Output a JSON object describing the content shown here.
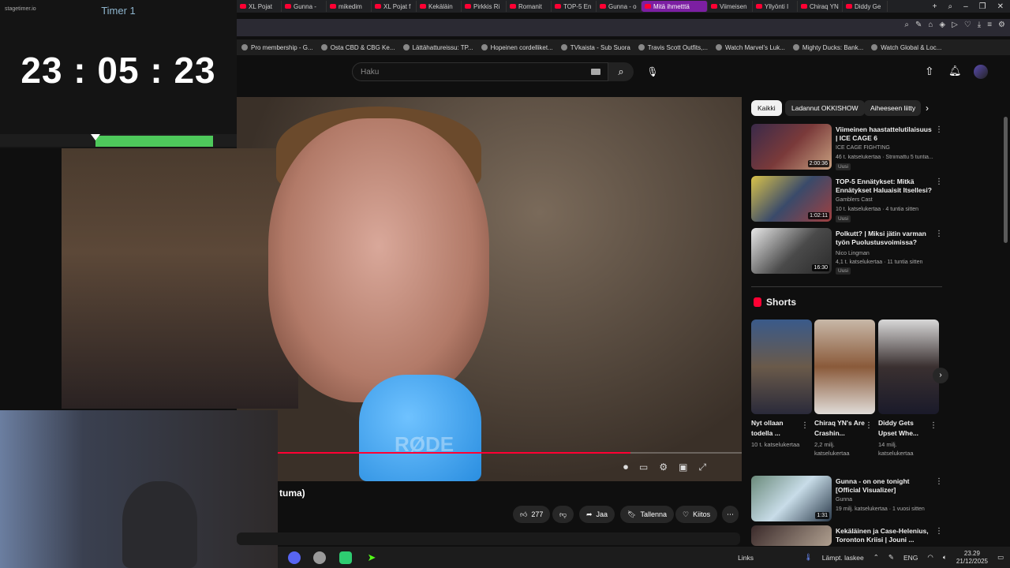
{
  "browser": {
    "tabs": [
      "XL Pojat",
      "Gunna -",
      "mikedim",
      "XL Pojat f",
      "Kekäläin",
      "Pirkkis Ri",
      "Romanit",
      "TOP-5 En",
      "Gunna - o",
      "Mitä ihmetttä",
      "Viimeisen",
      "Yllyönti I",
      "Chiraq YN",
      "Diddy Ge"
    ],
    "active_tab_index": 9,
    "bookmarks": [
      "Pro membership - G...",
      "Osta CBD & CBG Ke...",
      "Lättähattureissu: TP...",
      "Hopeinen cordelliket...",
      "TVkaista - Sub Suora",
      "Travis Scott Outfits,...",
      "Watch Marvel's Luk...",
      "Mighty Ducks: Bank...",
      "Watch Global & Loc..."
    ]
  },
  "timer": {
    "app_label": "stagetimer.io",
    "title": "Timer 1",
    "time": "23 : 05 : 23",
    "progress_fraction": 0.6
  },
  "youtube": {
    "search_placeholder": "Haku",
    "video_title_fragment": "tuma)",
    "video_progress_fraction": 0.78,
    "actions": {
      "likes": "277",
      "share": "Jaa",
      "save": "Tallenna",
      "thanks": "Kiitos"
    },
    "chips": [
      "Kaikki",
      "Ladannut OKKISHOW",
      "Aiheeseen liitty"
    ],
    "recommended": [
      {
        "title": "Viimeinen haastattelutilaisuus | ICE CAGE 6",
        "channel": "ICE CAGE FIGHTING",
        "meta": "46 t. katselukertaa · Striimattu 5 tuntia...",
        "duration": "2:00:36",
        "badge": "Uusi"
      },
      {
        "title": "TOP-5 Ennätykset: Mitkä Ennätykset Haluaisit Itsellesi?",
        "channel": "Gamblers Cast",
        "meta": "10 t. katselukertaa · 4 tuntia sitten",
        "duration": "1:02:11",
        "badge": "Uusi"
      },
      {
        "title": "Polkutt? | Miksi jätin varman työn Puolustusvoimissa?",
        "channel": "Nico Lingman",
        "meta": "4,1 t. katselukertaa · 11 tuntia sitten",
        "duration": "16:30",
        "badge": "Uusi"
      }
    ],
    "shorts_header": "Shorts",
    "shorts": [
      {
        "title": "Nyt ollaan todella ...",
        "views": "10 t. katselukertaa"
      },
      {
        "title": "Chiraq YN's Are Crashin...",
        "views": "2,2 milj. katselukertaa"
      },
      {
        "title": "Diddy Gets Upset Whe...",
        "views": "14 milj. katselukertaa"
      }
    ],
    "more": [
      {
        "title": "Gunna - on one tonight [Official Visualizer]",
        "channel": "Gunna",
        "meta": "19 milj. katselukertaa · 1 vuosi sitten",
        "duration": "1:31"
      },
      {
        "title": "Kekäläinen ja Case-Helenius, Toronton Kriisi | Jouni ...",
        "channel": "",
        "meta": "",
        "duration": ""
      }
    ]
  },
  "taskbar": {
    "links": "Links",
    "weather": "Lämpt. laskee",
    "lang": "ENG",
    "time": "23.29",
    "date": "21/12/2025"
  },
  "colors": {
    "accent_red": "#ff0033",
    "timer_green": "#4ec95b",
    "active_tab": "#7c1fa2"
  }
}
